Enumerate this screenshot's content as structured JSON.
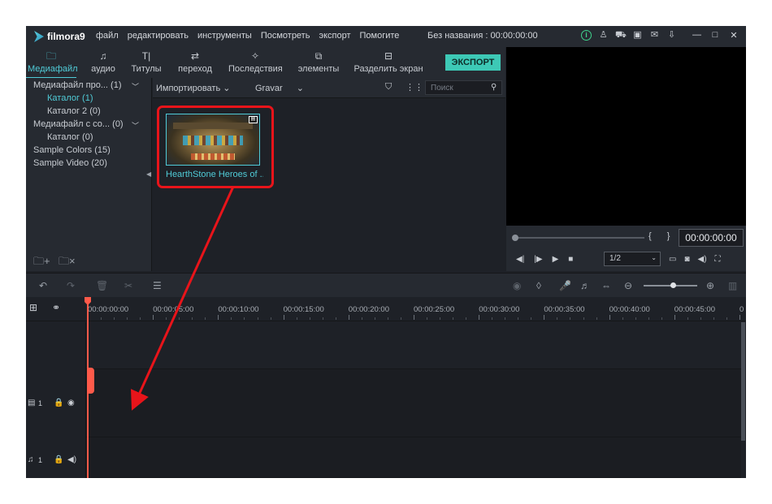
{
  "app": {
    "logo_text": "filmora9",
    "menu": [
      "файл",
      "редактировать",
      "инструменты",
      "Посмотреть",
      "экспорт",
      "Помогите"
    ],
    "project_title": "Без названия : 00:00:00:00",
    "window_controls": [
      "minimize-icon",
      "maximize-icon",
      "close-icon"
    ],
    "title_icons": [
      "info-icon",
      "account-icon",
      "cart-icon",
      "save-icon",
      "mail-icon",
      "download-icon"
    ]
  },
  "tabs": [
    {
      "label": "Медиафайл",
      "icon": "folder-icon",
      "active": true
    },
    {
      "label": "аудио",
      "icon": "music-note-icon",
      "active": false
    },
    {
      "label": "Титулы",
      "icon": "text-icon",
      "active": false
    },
    {
      "label": "переход",
      "icon": "transition-icon",
      "active": false
    },
    {
      "label": "Последствия",
      "icon": "effects-icon",
      "active": false
    },
    {
      "label": "элементы",
      "icon": "elements-icon",
      "active": false
    },
    {
      "label": "Разделить экран",
      "icon": "split-screen-icon",
      "active": false
    }
  ],
  "export_label": "ЭКСПОРТ",
  "library": {
    "items": [
      {
        "label": "Медиафайл про... (1)",
        "selected": false,
        "expandable": true
      },
      {
        "label": "Каталог (1)",
        "selected": true,
        "expandable": false
      },
      {
        "label": "Каталог 2 (0)",
        "selected": false,
        "expandable": false
      },
      {
        "label": "Медиафайл с со... (0)",
        "selected": false,
        "expandable": true
      },
      {
        "label": "Каталог (0)",
        "selected": false,
        "expandable": false
      },
      {
        "label": "Sample Colors (15)",
        "selected": false,
        "expandable": false
      },
      {
        "label": "Sample Video (20)",
        "selected": false,
        "expandable": false
      }
    ]
  },
  "media_toolbar": {
    "import_label": "Импортировать",
    "sort_label": "Gravar",
    "search_placeholder": "Поиск"
  },
  "media_items": [
    {
      "name": "HearthStone  Heroes of ...",
      "type": "video"
    }
  ],
  "preview": {
    "timecode": "00:00:00:00",
    "quality": "1/2",
    "in_out_markers": "{ }"
  },
  "timeline": {
    "ruler_labels": [
      "00:00:00:00",
      "00:00:05:00",
      "00:00:10:00",
      "00:00:15:00",
      "00:00:20:00",
      "00:00:25:00",
      "00:00:30:00",
      "00:00:35:00",
      "00:00:40:00",
      "00:00:45:00",
      "0"
    ],
    "zoom_level": 0.55,
    "tracks": [
      {
        "kind": "video",
        "label": "1"
      },
      {
        "kind": "audio",
        "label": "1"
      }
    ]
  },
  "colors": {
    "accent": "#50cbd7",
    "export": "#3dc9b6",
    "playhead": "#ff5a4a",
    "annotation": "#e8141a",
    "background": "#1e2127"
  }
}
